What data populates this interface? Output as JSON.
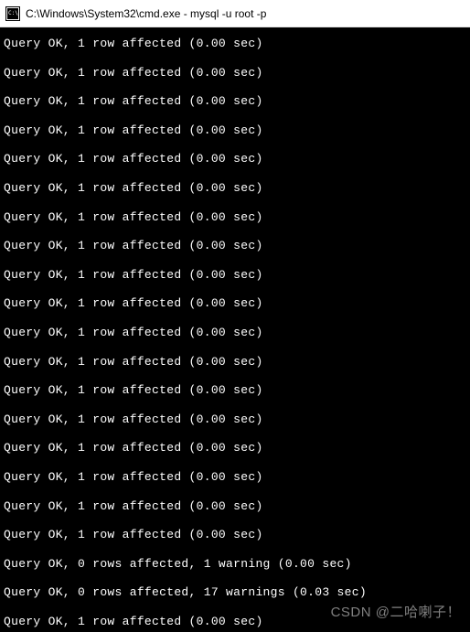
{
  "titlebar": {
    "icon_name": "cmd-icon",
    "title": "C:\\Windows\\System32\\cmd.exe - mysql  -u root -p"
  },
  "terminal": {
    "lines": [
      "Query OK, 1 row affected (0.00 sec)",
      "Query OK, 1 row affected (0.00 sec)",
      "Query OK, 1 row affected (0.00 sec)",
      "Query OK, 1 row affected (0.00 sec)",
      "Query OK, 1 row affected (0.00 sec)",
      "Query OK, 1 row affected (0.00 sec)",
      "Query OK, 1 row affected (0.00 sec)",
      "Query OK, 1 row affected (0.00 sec)",
      "Query OK, 1 row affected (0.00 sec)",
      "Query OK, 1 row affected (0.00 sec)",
      "Query OK, 1 row affected (0.00 sec)",
      "Query OK, 1 row affected (0.00 sec)",
      "Query OK, 1 row affected (0.00 sec)",
      "Query OK, 1 row affected (0.00 sec)",
      "Query OK, 1 row affected (0.00 sec)",
      "Query OK, 1 row affected (0.00 sec)",
      "Query OK, 1 row affected (0.00 sec)",
      "Query OK, 1 row affected (0.00 sec)",
      "Query OK, 0 rows affected, 1 warning (0.00 sec)",
      "Query OK, 0 rows affected, 17 warnings (0.03 sec)",
      "Query OK, 1 row affected (0.00 sec)"
    ]
  },
  "watermark": {
    "text": "CSDN @二哈喇子！"
  }
}
